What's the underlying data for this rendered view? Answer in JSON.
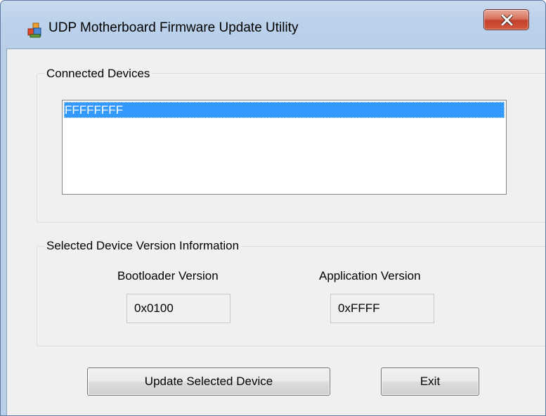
{
  "window": {
    "title": "UDP Motherboard Firmware Update Utility",
    "close_symbol": "x"
  },
  "icons": {
    "app": "application-icon",
    "close": "close-icon"
  },
  "connected_devices": {
    "label": "Connected Devices",
    "items": [
      "FFFFFFFF"
    ],
    "selected_index": 0
  },
  "version_info": {
    "label": "Selected Device Version Information",
    "bootloader": {
      "label": "Bootloader Version",
      "value": "0x0100"
    },
    "application": {
      "label": "Application Version",
      "value": "0xFFFF"
    }
  },
  "buttons": {
    "update": "Update Selected Device",
    "exit": "Exit"
  },
  "colors": {
    "selection": "#3399ff",
    "client_background": "#f0f0f0",
    "titlebar": "#bcd1ea",
    "close_button": "#c4412b"
  }
}
